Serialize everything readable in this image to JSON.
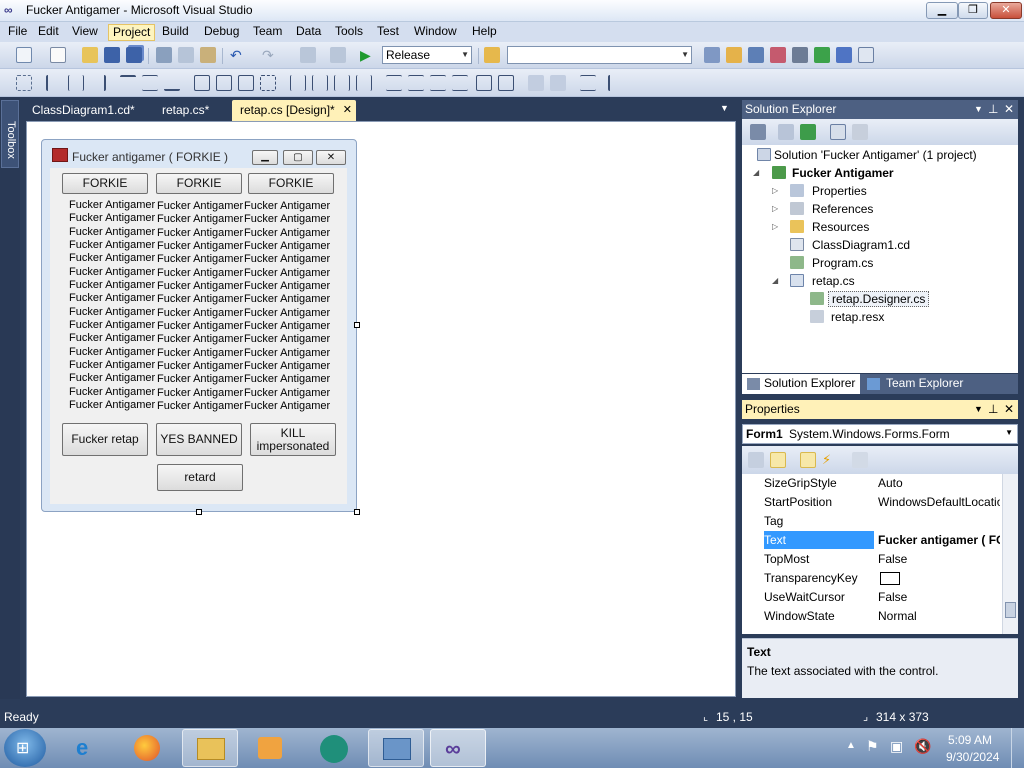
{
  "window": {
    "title": "Fucker Antigamer - Microsoft Visual Studio"
  },
  "menu": [
    "File",
    "Edit",
    "View",
    "Project",
    "Build",
    "Debug",
    "Team",
    "Data",
    "Tools",
    "Test",
    "Window",
    "Help"
  ],
  "toolbar": {
    "config": "Release",
    "platform": ""
  },
  "tabs": [
    {
      "label": "ClassDiagram1.cd*"
    },
    {
      "label": "retap.cs*"
    },
    {
      "label": "retap.cs [Design]*"
    }
  ],
  "form": {
    "title": "Fucker antigamer ( FORKIE )",
    "top_buttons": [
      "FORKIE",
      "FORKIE",
      "FORKIE"
    ],
    "label_text": "Fucker Antigamer",
    "buttons": {
      "retap": "Fucker retap",
      "banned": "YES BANNED",
      "kill_line1": "KILL",
      "kill_line2": "impersonated",
      "retard": "retard"
    }
  },
  "solution_explorer": {
    "title": "Solution Explorer",
    "solution": "Solution 'Fucker Antigamer' (1 project)",
    "project": "Fucker Antigamer",
    "items": [
      "Properties",
      "References",
      "Resources",
      "ClassDiagram1.cd",
      "Program.cs",
      "retap.cs"
    ],
    "children": [
      "retap.Designer.cs",
      "retap.resx"
    ],
    "tab_solution": "Solution Explorer",
    "tab_team": "Team Explorer"
  },
  "properties": {
    "title": "Properties",
    "object_name": "Form1",
    "object_type": "System.Windows.Forms.Form",
    "rows": [
      {
        "name": "SizeGripStyle",
        "value": "Auto"
      },
      {
        "name": "StartPosition",
        "value": "WindowsDefaultLocation"
      },
      {
        "name": "Tag",
        "value": ""
      },
      {
        "name": "Text",
        "value": "Fucker antigamer ( FORKIE )"
      },
      {
        "name": "TopMost",
        "value": "False"
      },
      {
        "name": "TransparencyKey",
        "value": ""
      },
      {
        "name": "UseWaitCursor",
        "value": "False"
      },
      {
        "name": "WindowState",
        "value": "Normal"
      }
    ],
    "desc_title": "Text",
    "desc_text": "The text associated with the control."
  },
  "status": {
    "ready": "Ready",
    "position": "15 , 15",
    "size": "314 x 373"
  },
  "clock": {
    "time": "5:09 AM",
    "date": "9/30/2024"
  },
  "colors": {
    "accent_tab": "#fff1b8",
    "selection": "#3399ff",
    "chrome": "#2b3c59"
  }
}
